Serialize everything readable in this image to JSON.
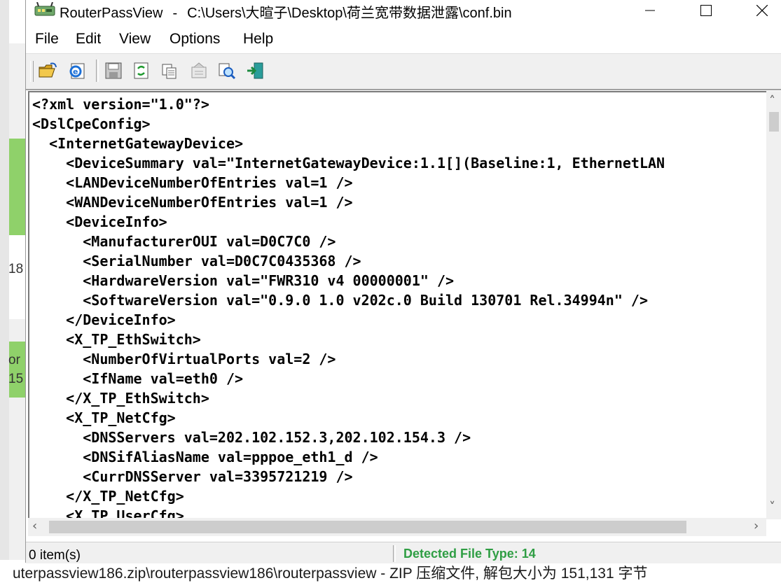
{
  "window": {
    "app_name": "RouterPassView",
    "separator": "-",
    "file_path": "C:\\Users\\大暄子\\Desktop\\荷兰宽带数据泄露\\conf.bin"
  },
  "menu": {
    "items": [
      "File",
      "Edit",
      "View",
      "Options",
      "Help"
    ]
  },
  "toolbar": {
    "buttons": [
      "open-file-icon",
      "open-ie-icon",
      "save-icon",
      "refresh-icon",
      "copy-icon",
      "properties-icon",
      "find-icon",
      "exit-icon"
    ]
  },
  "content": {
    "lines": [
      "<?xml version=\"1.0\"?>",
      "<DslCpeConfig>",
      "  <InternetGatewayDevice>",
      "    <DeviceSummary val=\"InternetGatewayDevice:1.1[](Baseline:1, EthernetLAN",
      "    <LANDeviceNumberOfEntries val=1 />",
      "    <WANDeviceNumberOfEntries val=1 />",
      "    <DeviceInfo>",
      "      <ManufacturerOUI val=D0C7C0 />",
      "      <SerialNumber val=D0C7C0435368 />",
      "      <HardwareVersion val=\"FWR310 v4 00000001\" />",
      "      <SoftwareVersion val=\"0.9.0 1.0 v202c.0 Build 130701 Rel.34994n\" />",
      "    </DeviceInfo>",
      "    <X_TP_EthSwitch>",
      "      <NumberOfVirtualPorts val=2 />",
      "      <IfName val=eth0 />",
      "    </X_TP_EthSwitch>",
      "    <X_TP_NetCfg>",
      "      <DNSServers val=202.102.152.3,202.102.154.3 />",
      "      <DNSifAliasName val=pppoe_eth1_d />",
      "      <CurrDNSServer val=3395721219 />",
      "    </X_TP_NetCfg>",
      "    <X_TP_UserCfg>"
    ]
  },
  "status": {
    "items_count": "0 item(s)",
    "detected_type": "Detected File Type: 14"
  },
  "background": {
    "left_fragments": [
      "18",
      "or",
      "15"
    ],
    "footer_text": "uterpassview186.zip\\routerpassview186\\routerpassview - ZIP 压缩文件, 解包大小为 151,131 字节"
  },
  "colors": {
    "status_green": "#2f9e44",
    "background_green": "#8fd16a"
  }
}
